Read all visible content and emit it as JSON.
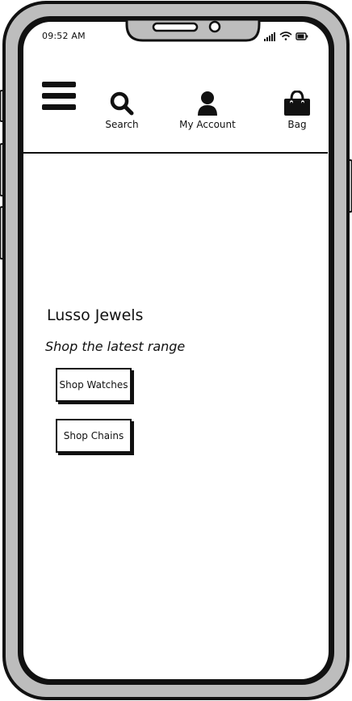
{
  "status_bar": {
    "time": "09:52 AM",
    "icons": [
      "signal-icon",
      "wifi-icon",
      "battery-icon"
    ]
  },
  "header": {
    "menu_icon": "hamburger-menu-icon",
    "nav": [
      {
        "label": "Search",
        "icon": "search-icon"
      },
      {
        "label": "My Account",
        "icon": "user-icon"
      },
      {
        "label": "Bag",
        "icon": "shopping-bag-icon"
      }
    ]
  },
  "hero": {
    "brand": "Lusso Jewels",
    "tagline": "Shop the latest range",
    "buttons": [
      {
        "label": "Shop Watches"
      },
      {
        "label": "Shop Chains"
      }
    ]
  },
  "colors": {
    "device_frame": "#bdbdbd",
    "outline": "#111111",
    "screen": "#ffffff"
  }
}
